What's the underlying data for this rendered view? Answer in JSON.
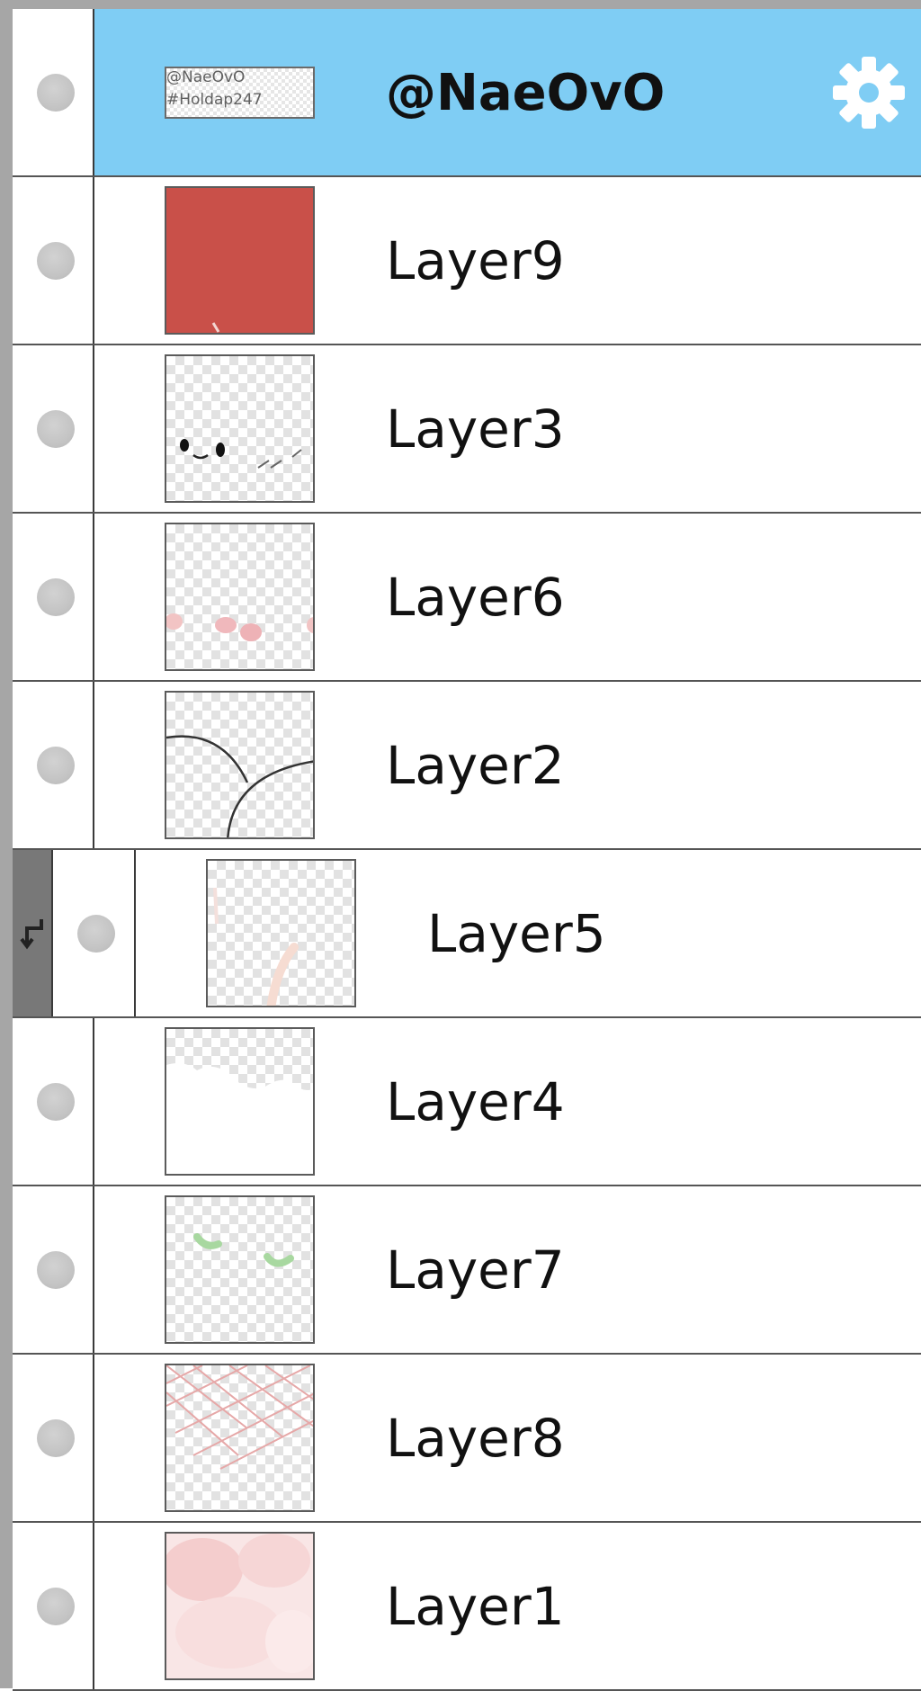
{
  "colors": {
    "selected_bg": "#7fcdf4",
    "layer9_fill": "#c95049",
    "settings_icon": "#ffffff",
    "visibility_dot": "#c4c4c4"
  },
  "layers": [
    {
      "name": "@NaeOvO",
      "selected": true,
      "thumb": "text",
      "thumb_lines": [
        "@NaeOvO",
        "#Holdap247"
      ],
      "settings_icon": "gear-icon"
    },
    {
      "name": "Layer9",
      "thumb": "solid-red"
    },
    {
      "name": "Layer3",
      "thumb": "eyes"
    },
    {
      "name": "Layer6",
      "thumb": "pink-blush"
    },
    {
      "name": "Layer2",
      "thumb": "arcs"
    },
    {
      "name": "Layer5",
      "thumb": "faint",
      "clipped": true,
      "clip_icon": "clip-arrow-icon"
    },
    {
      "name": "Layer4",
      "thumb": "white-fill"
    },
    {
      "name": "Layer7",
      "thumb": "green-marks"
    },
    {
      "name": "Layer8",
      "thumb": "crosshatch"
    },
    {
      "name": "Layer1",
      "thumb": "pink-wash"
    }
  ]
}
